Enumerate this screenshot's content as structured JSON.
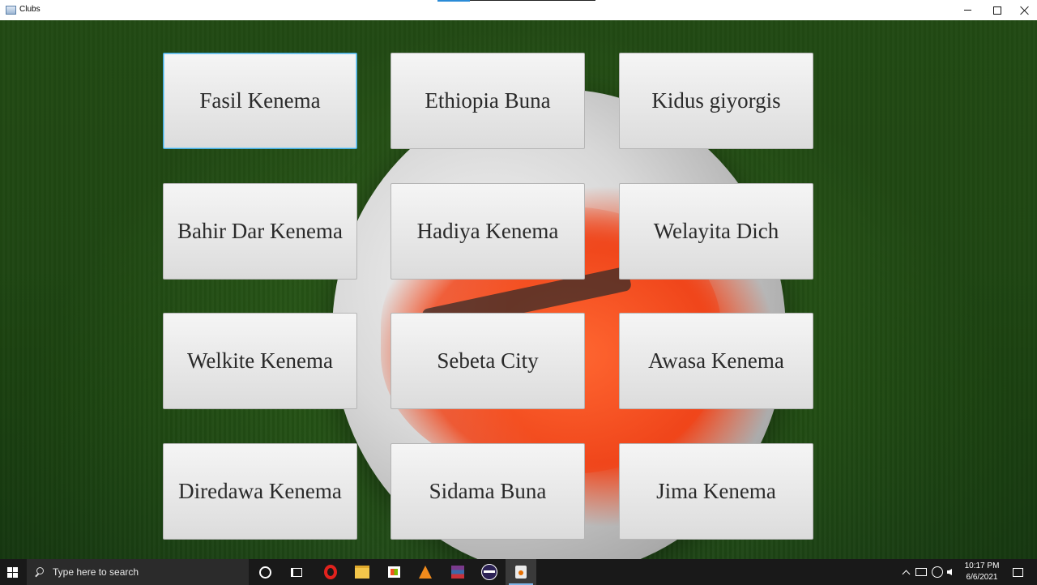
{
  "window": {
    "title": "Clubs",
    "controls": [
      "minimize",
      "maximize",
      "close"
    ]
  },
  "clubs": {
    "items": [
      {
        "label": "Fasil Kenema",
        "focused": true
      },
      {
        "label": "Ethiopia Buna"
      },
      {
        "label": "Kidus giyorgis"
      },
      {
        "label": "Bahir Dar Kenema"
      },
      {
        "label": "Hadiya Kenema"
      },
      {
        "label": "Welayita Dich"
      },
      {
        "label": "Welkite Kenema"
      },
      {
        "label": "Sebeta City"
      },
      {
        "label": "Awasa Kenema"
      },
      {
        "label": "Diredawa Kenema"
      },
      {
        "label": "Sidama Buna"
      },
      {
        "label": "Jima Kenema"
      }
    ]
  },
  "taskbar": {
    "search_placeholder": "Type here to search",
    "apps": [
      "cortana-icon",
      "task-view-icon",
      "opera-icon",
      "file-explorer-icon",
      "microsoft-store-icon",
      "vlc-icon",
      "winrar-icon",
      "eclipse-icon",
      "java-icon"
    ],
    "active_app": "java-icon",
    "time": "10:17 PM",
    "date": "6/6/2021"
  },
  "colors": {
    "focus_border": "#3fa7dc",
    "button_bg": "#e6e6e6",
    "taskbar_bg": "#191919"
  }
}
